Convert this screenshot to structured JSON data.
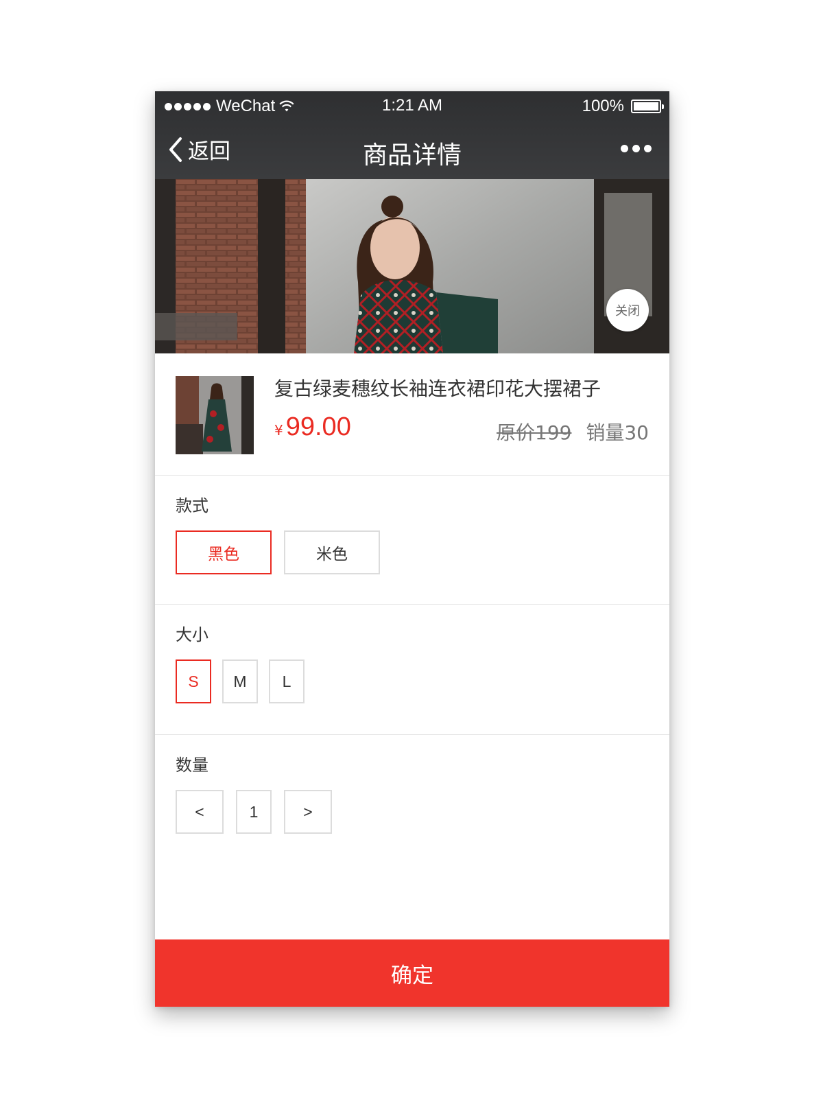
{
  "status_bar": {
    "carrier": "WeChat",
    "time": "1:21 AM",
    "battery": "100%",
    "battery_level": 1.0,
    "signal_icon": "signal-dots-icon",
    "wifi_icon": "wifi-icon"
  },
  "nav": {
    "back_label": "返回",
    "title": "商品详情",
    "more_icon": "more-dots-icon"
  },
  "banner": {
    "close_label": "关闭"
  },
  "product": {
    "name": "复古绿麦穗纹长袖连衣裙印花大摆裙子",
    "currency": "¥",
    "price": "99.00",
    "original_price": "原价199",
    "sales": "销量30"
  },
  "style_section": {
    "label": "款式",
    "options": [
      "黑色",
      "米色"
    ],
    "selected": "黑色"
  },
  "size_section": {
    "label": "大小",
    "options": [
      "S",
      "M",
      "L"
    ],
    "selected": "S"
  },
  "quantity_section": {
    "label": "数量",
    "decrement": "<",
    "value": "1",
    "increment": ">"
  },
  "confirm_label": "确定",
  "colors": {
    "accent": "#ea2b22",
    "confirm_bg": "#f0342c",
    "topbar": "#333436"
  }
}
